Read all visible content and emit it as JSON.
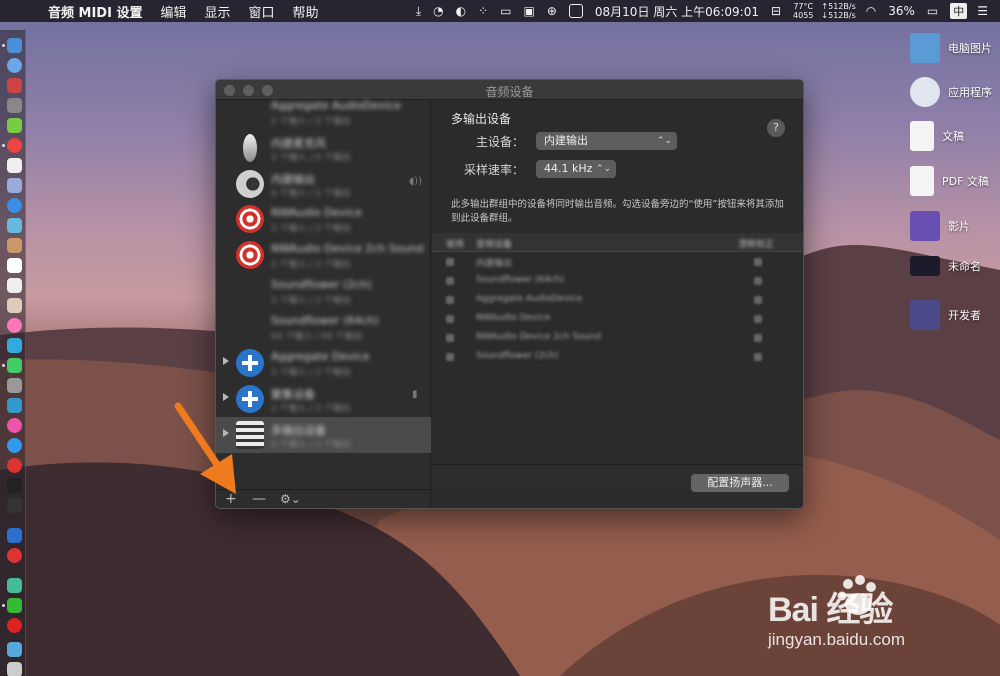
{
  "menubar": {
    "app_name": "音频 MIDI 设置",
    "items": [
      "编辑",
      "显示",
      "窗口",
      "帮助"
    ],
    "datetime": "08月10日 周六 上午06:09:01",
    "sensor_temp": "77°C",
    "sensor_rpm": "4055",
    "net_up": "↑512B/s",
    "net_down": "↓512B/s",
    "battery": "36%",
    "input_method": "中"
  },
  "desktop": {
    "items": [
      {
        "label": "电脑图片",
        "icon": "folder-icon",
        "color": "#5b9bd5"
      },
      {
        "label": "应用程序",
        "icon": "applications-icon",
        "color": "#dfe6ee"
      },
      {
        "label": "文稿",
        "icon": "document-icon",
        "color": "#f4f4f4"
      },
      {
        "label": "PDF 文稿",
        "icon": "pdf-document-icon",
        "color": "#f4f4f4"
      },
      {
        "label": "影片",
        "icon": "movie-icon",
        "color": "#6a4fb3"
      },
      {
        "label": "未命名",
        "icon": "screenshot-icon",
        "color": "#1b1b2b"
      },
      {
        "label": "开发者",
        "icon": "developer-icon",
        "color": "#4a4a8a"
      }
    ]
  },
  "window": {
    "title": "音频设备",
    "devices": [
      {
        "name": "Aggregate AudioDevice",
        "sub": "2 个输入 / 2 个输出",
        "icon": "none",
        "disclosure": false
      },
      {
        "name": "内建麦克风",
        "sub": "2 个输入 / 0 个输出",
        "icon": "microphone-icon",
        "disclosure": false
      },
      {
        "name": "内建输出",
        "sub": "0 个输入 / 2 个输出",
        "icon": "speaker-icon",
        "disclosure": false
      },
      {
        "name": "NWAudio Device",
        "sub": "2 个输入 / 2 个输出",
        "icon": "target-icon",
        "disclosure": false
      },
      {
        "name": "NWAudio Device 2ch Sound",
        "sub": "2 个输入 / 2 个输出",
        "icon": "target-icon",
        "disclosure": false
      },
      {
        "name": "Soundflower (2ch)",
        "sub": "2 个输入 / 2 个输出",
        "icon": "none",
        "disclosure": false
      },
      {
        "name": "Soundflower (64ch)",
        "sub": "64 个输入 / 64 个输出",
        "icon": "none",
        "disclosure": false
      },
      {
        "name": "Aggregate Device",
        "sub": "2 个输入 / 2 个输出",
        "icon": "plus-icon",
        "disclosure": true
      },
      {
        "name": "聚集设备",
        "sub": "2 个输入 / 2 个输出",
        "icon": "plus-icon",
        "disclosure": true
      },
      {
        "name": "多输出设备",
        "sub": "0 个输入 / 2 个输出",
        "icon": "stack-icon",
        "disclosure": true
      }
    ],
    "sidebar_footer": {
      "add": "+",
      "remove": "—",
      "gear": "⚙⌄"
    },
    "detail": {
      "heading": "多输出设备",
      "master_label": "主设备：",
      "master_value": "内建输出",
      "rate_label": "采样速率：",
      "rate_value": "44.1 kHz",
      "description": "此多输出群组中的设备将同时输出音频。勾选设备旁边的“使用”按钮来将其添加到此设备群组。",
      "help": "?",
      "columns": [
        "使用",
        "音频设备",
        "漂移校正"
      ],
      "rows": [
        "内建输出",
        "Soundflower (64ch)",
        "Aggregate AudioDevice",
        "NWAudio Device",
        "NWAudio Device 2ch Sound",
        "Soundflower (2ch)"
      ],
      "configure_button": "配置扬声器..."
    }
  },
  "watermark": {
    "logo": "Bai  经验",
    "url": "jingyan.baidu.com"
  },
  "colors": {
    "arrow": "#f07a1e",
    "accent_blue": "#2a74c9",
    "accent_red": "#d2312c"
  }
}
